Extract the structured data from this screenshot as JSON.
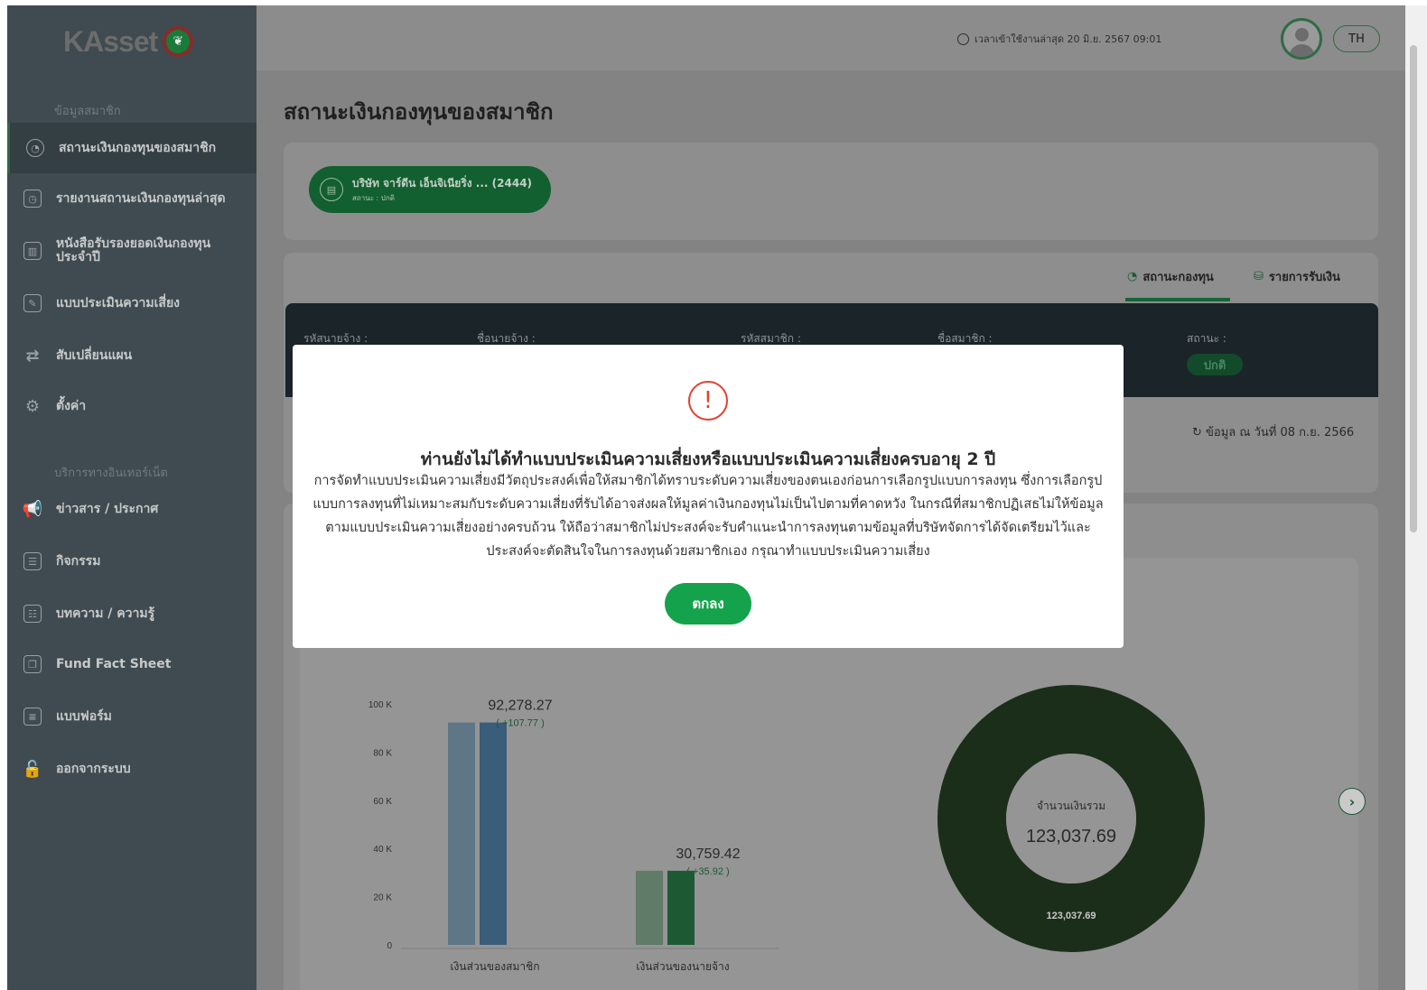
{
  "brand": {
    "name": "KAsset",
    "mark_icon": "kbank-leaf-icon"
  },
  "sidebar": {
    "section_member": "ข้อมูลสมาชิก",
    "section_internet": "บริการทางอินเทอร์เน็ต",
    "items": [
      {
        "label": "สถานะเงินกองทุนของสมาชิก",
        "icon": "pie-chart-icon",
        "active": true
      },
      {
        "label": "รายงานสถานะเงินกองทุนล่าสุด",
        "icon": "report-icon"
      },
      {
        "label": "หนังสือรับรองยอดเงินกองทุน ประจำปี",
        "icon": "certificate-icon"
      },
      {
        "label": "แบบประเมินความเสี่ยง",
        "icon": "assessment-icon"
      },
      {
        "label": "สับเปลี่ยนแผน",
        "icon": "switch-icon"
      },
      {
        "label": "ตั้งค่า",
        "icon": "gear-icon"
      },
      {
        "label": "ข่าวสาร / ประกาศ",
        "icon": "megaphone-icon"
      },
      {
        "label": "กิจกรรม",
        "icon": "activity-icon"
      },
      {
        "label": "บทความ / ความรู้",
        "icon": "article-icon"
      },
      {
        "label": "Fund Fact Sheet",
        "icon": "factsheet-icon"
      },
      {
        "label": "แบบฟอร์ม",
        "icon": "form-icon"
      },
      {
        "label": "ออกจากระบบ",
        "icon": "lock-icon"
      }
    ]
  },
  "topbar": {
    "login_time": "เวลาเข้าใช้งานล่าสุด 20 มิ.ย. 2567 09:01",
    "language": "TH"
  },
  "page": {
    "title": "สถานะเงินกองทุนของสมาชิก",
    "company": {
      "name": "บริษัท จาร์ดีน เอ็นจิเนียริ่ง ... (2444)",
      "status": "สถานะ : ปกติ"
    },
    "tabs": [
      {
        "label": "สถานะกองทุน",
        "active": true
      },
      {
        "label": "รายการรับเงิน"
      }
    ],
    "info_labels": {
      "employer_code": "รหัสนายจ้าง :",
      "employer_name": "ชื่อนายจ้าง :",
      "member_code": "รหัสสมาชิก :",
      "member_name": "ชื่อสมาชิก :",
      "status": "สถานะ :"
    },
    "status_value": "ปกติ",
    "as_of": "ข้อมูล ณ วันที่ 08 ก.ย. 2566"
  },
  "chart_data": [
    {
      "type": "bar",
      "categories": [
        "เงินส่วนของสมาชิก",
        "เงินส่วนของนายจ้าง"
      ],
      "series": [
        {
          "values": [
            92278.27,
            30759.42
          ]
        },
        {
          "values": [
            92278.27,
            30759.42
          ]
        }
      ],
      "value_labels": [
        "92,278.27",
        "30,759.42"
      ],
      "change_labels": [
        "( +107.77 )",
        "( +35.92 )"
      ],
      "yticks": [
        "100 K",
        "80 K",
        "60 K",
        "40 K",
        "20 K",
        "0"
      ],
      "ylim": [
        0,
        100000
      ],
      "colors": {
        "member": [
          "#5f7686",
          "#3a5d79"
        ],
        "employer": [
          "#607b67",
          "#1d5a34"
        ]
      }
    },
    {
      "type": "pie",
      "center_label": "จำนวนเงินรวม",
      "center_value": "123,037.69",
      "slices": [
        {
          "label": "123,037.69",
          "value": 123037.69
        }
      ],
      "color": "#1b2e19"
    }
  ],
  "modal": {
    "icon": "warning-icon",
    "title": "ท่านยังไม่ได้ทำแบบประเมินความเสี่ยงหรือแบบประเมินความเสี่ยงครบอายุ 2 ปี",
    "body": "การจัดทำแบบประเมินความเสี่ยงมีวัตถุประสงค์เพื่อให้สมาชิกได้ทราบระดับความเสี่ยงของตนเองก่อนการเลือกรูปแบบการลงทุน ซึ่งการเลือกรูปแบบการลงทุนที่ไม่เหมาะสมกับระดับความเสี่ยงที่รับได้อาจส่งผลให้มูลค่าเงินกองทุนไม่เป็นไปตามที่คาดหวัง ในกรณีที่สมาชิกปฏิเสธไม่ให้ข้อมูลตามแบบประเมินความเสี่ยงอย่างครบถ้วน ให้ถือว่าสมาชิกไม่ประสงค์จะรับคำแนะนำการลงทุนตามข้อมูลที่บริษัทจัดการได้จัดเตรียมไว้และประสงค์จะตัดสินใจในการลงทุนด้วยสมาชิกเอง กรุณาทำแบบประเมินความเสี่ยง",
    "ok_label": "ตกลง"
  }
}
